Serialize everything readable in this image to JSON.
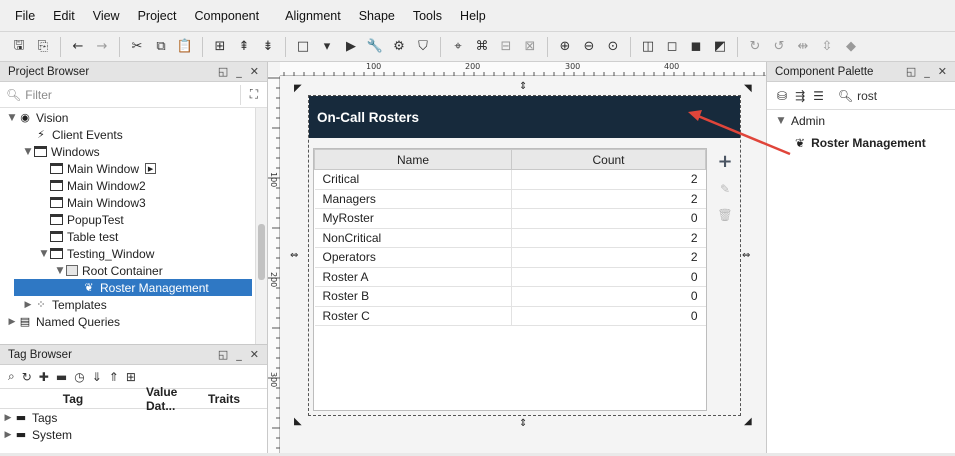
{
  "menubar": [
    "File",
    "Edit",
    "View",
    "Project",
    "Component",
    "Alignment",
    "Shape",
    "Tools",
    "Help"
  ],
  "project_browser": {
    "title": "Project Browser",
    "filter_placeholder": "Filter",
    "tree": [
      {
        "label": "Vision",
        "level": 0,
        "arrow": "▼",
        "icon": "vision-icon"
      },
      {
        "label": "Client Events",
        "level": 1,
        "arrow": "",
        "icon": "client-events-icon"
      },
      {
        "label": "Windows",
        "level": 1,
        "arrow": "▼",
        "icon": "window-icon"
      },
      {
        "label": "Main Window",
        "level": 2,
        "arrow": "",
        "icon": "window-icon",
        "badge": true
      },
      {
        "label": "Main Window2",
        "level": 2,
        "arrow": "",
        "icon": "window-icon"
      },
      {
        "label": "Main Window3",
        "level": 2,
        "arrow": "",
        "icon": "window-icon"
      },
      {
        "label": "PopupTest",
        "level": 2,
        "arrow": "",
        "icon": "window-icon"
      },
      {
        "label": "Table test",
        "level": 2,
        "arrow": "",
        "icon": "window-icon"
      },
      {
        "label": "Testing_Window",
        "level": 2,
        "arrow": "▼",
        "icon": "window-icon"
      },
      {
        "label": "Root Container",
        "level": 3,
        "arrow": "▼",
        "icon": "container-icon"
      },
      {
        "label": "Roster Management",
        "level": 4,
        "arrow": "",
        "icon": "roster-icon",
        "selected": true
      },
      {
        "label": "Templates",
        "level": 1,
        "arrow": "▶",
        "icon": "templates-icon"
      },
      {
        "label": "Named Queries",
        "level": 0,
        "arrow": "▶",
        "icon": "named-queries-icon"
      }
    ]
  },
  "tag_browser": {
    "title": "Tag Browser",
    "columns": [
      "Tag",
      "Value Dat...",
      "Traits"
    ],
    "rows": [
      "Tags",
      "System"
    ]
  },
  "designer": {
    "ruler_labels": [
      "100",
      "200",
      "300",
      "400"
    ],
    "left_ruler_labels": [
      "100",
      "200",
      "300"
    ],
    "window_title": "On-Call Rosters",
    "table": {
      "columns": [
        "Name",
        "Count"
      ],
      "rows": [
        [
          "Critical",
          "2"
        ],
        [
          "Managers",
          "2"
        ],
        [
          "MyRoster",
          "0"
        ],
        [
          "NonCritical",
          "2"
        ],
        [
          "Operators",
          "2"
        ],
        [
          "Roster A",
          "0"
        ],
        [
          "Roster B",
          "0"
        ],
        [
          "Roster C",
          "0"
        ]
      ]
    }
  },
  "component_palette": {
    "title": "Component Palette",
    "search_value": "rost",
    "category": "Admin",
    "item": "Roster Management"
  },
  "colors": {
    "title_bar": "#172a3c",
    "selection": "#2f78c4",
    "annotation_arrow": "#e0453a"
  }
}
